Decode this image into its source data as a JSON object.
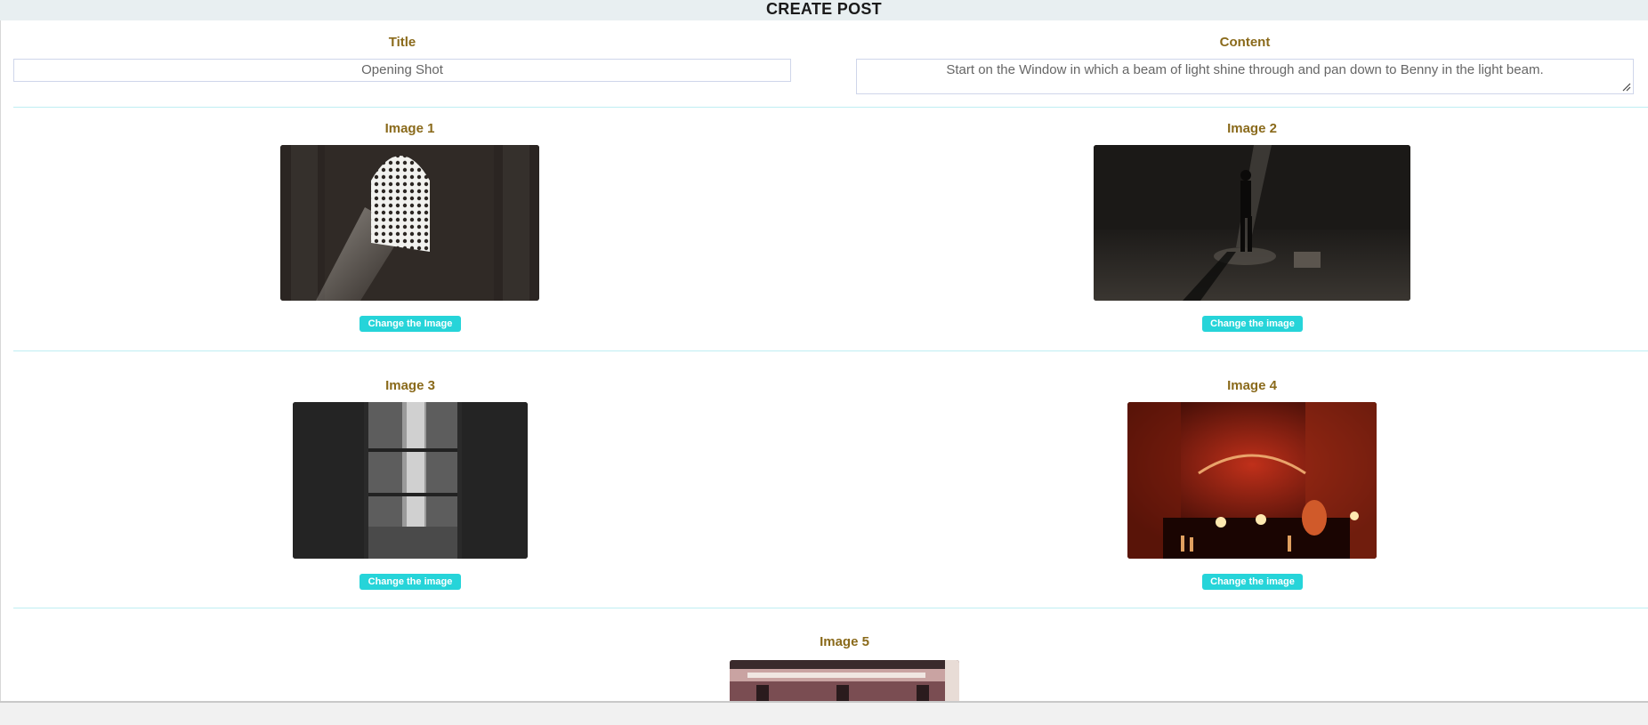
{
  "header": {
    "title": "CREATE POST"
  },
  "form": {
    "title_label": "Title",
    "title_value": "Opening Shot",
    "content_label": "Content",
    "content_value": "Start on the Window in which a beam of light shine through and pan down to Benny in the light beam."
  },
  "images": [
    {
      "label": "Image 1",
      "button": "Change the Image",
      "description": "window-light-beam"
    },
    {
      "label": "Image 2",
      "button": "Change the image",
      "description": "man-in-light-beam"
    },
    {
      "label": "Image 3",
      "button": "Change the image",
      "description": "curtained-window"
    },
    {
      "label": "Image 4",
      "button": "Change the image",
      "description": "red-bar-interior"
    },
    {
      "label": "Image 5",
      "description": "building-facade"
    }
  ],
  "colors": {
    "label": "#8a6a1b",
    "button": "#26d4d9",
    "divider": "#bfeef2",
    "header_bg": "#e8eff1"
  }
}
